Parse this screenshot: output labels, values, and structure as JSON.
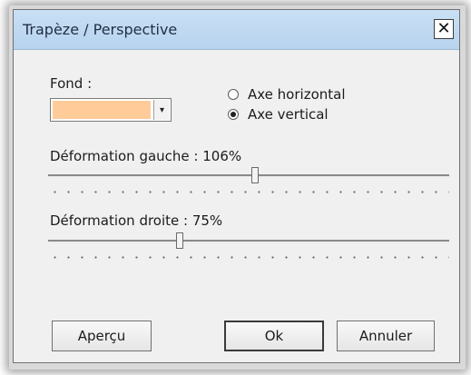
{
  "window": {
    "title": "Trapèze / Perspective",
    "close_glyph": "✕"
  },
  "fond": {
    "label": "Fond :",
    "color": "#FFCC99",
    "dropdown_glyph": "▾"
  },
  "axis": {
    "options": [
      {
        "label": "Axe horizontal",
        "selected": false
      },
      {
        "label": "Axe vertical",
        "selected": true
      }
    ]
  },
  "deformation_left": {
    "label": "Déformation gauche : 106%",
    "value_fraction": 0.515
  },
  "deformation_right": {
    "label": "Déformation droite : 75%",
    "value_fraction": 0.325
  },
  "buttons": {
    "preview": "Aperçu",
    "ok": "Ok",
    "cancel": "Annuler"
  },
  "colors": {
    "titlebar": "#C9E0F5",
    "dialog_bg": "#F0F0F0",
    "swatch": "#FFCC99"
  }
}
